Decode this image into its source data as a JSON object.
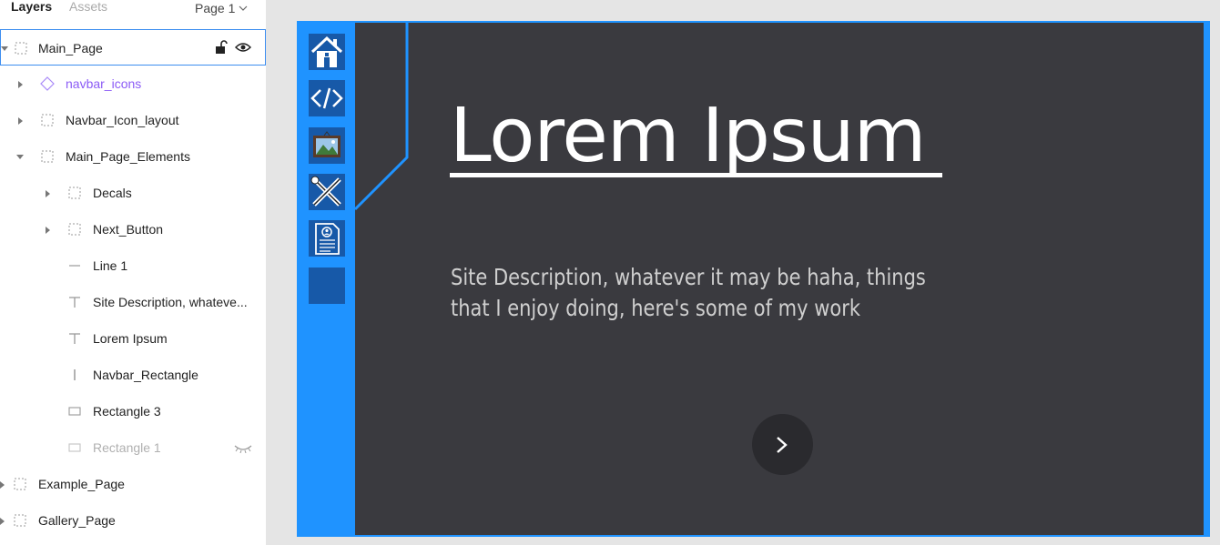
{
  "panel": {
    "tabs": {
      "layers": "Layers",
      "assets": "Assets"
    },
    "page_selector": "Page 1",
    "layers": [
      {
        "name": "Main_Page"
      },
      {
        "name": "navbar_icons"
      },
      {
        "name": "Navbar_Icon_layout"
      },
      {
        "name": "Main_Page_Elements"
      },
      {
        "name": "Decals"
      },
      {
        "name": "Next_Button"
      },
      {
        "name": "Line 1"
      },
      {
        "name": "Site Description, whateve..."
      },
      {
        "name": "Lorem Ipsum"
      },
      {
        "name": "Navbar_Rectangle"
      },
      {
        "name": "Rectangle 3"
      },
      {
        "name": "Rectangle 1"
      },
      {
        "name": "Example_Page"
      },
      {
        "name": "Gallery_Page"
      }
    ]
  },
  "canvas": {
    "title": "Lorem Ipsum",
    "description": "Site Description, whatever it may be haha, things that I enjoy doing, here's some of my work",
    "next_glyph": ">",
    "nav_icons": [
      "home-icon",
      "code-icon",
      "picture-frame-icon",
      "brush-pencil-icon",
      "resume-icon",
      "blank-tile"
    ]
  },
  "colors": {
    "accent_blue": "#1f93ff",
    "nav_tile": "#1759a8",
    "main_bg": "#3a3a3f",
    "selection": "#3d8ef0",
    "component": "#8c5cf6"
  }
}
